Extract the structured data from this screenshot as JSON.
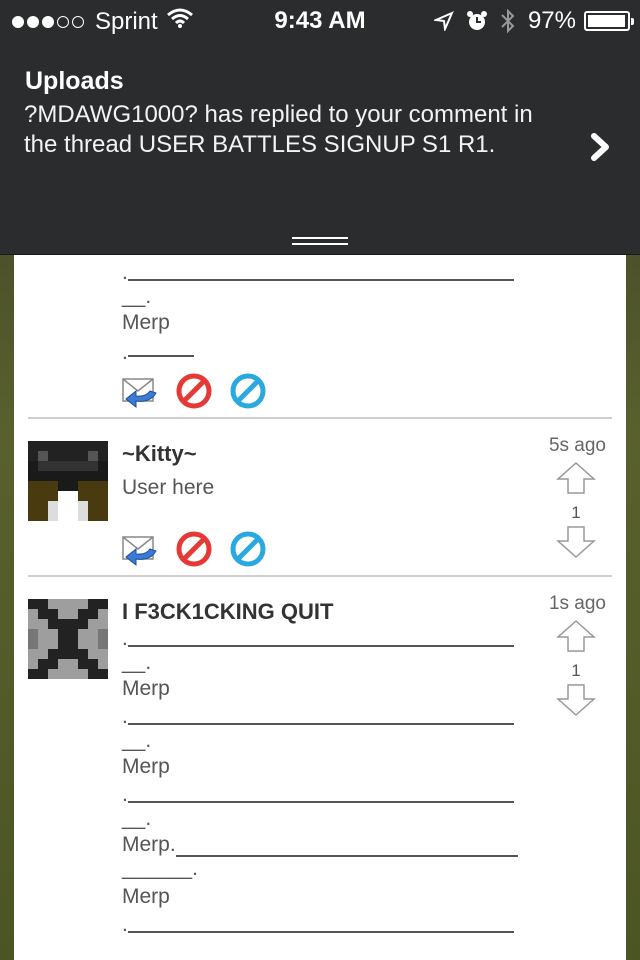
{
  "status_bar": {
    "carrier": "Sprint",
    "time": "9:43 AM",
    "battery": "97%",
    "battery_level": 0.97,
    "signal_bars_filled": 3,
    "signal_bars_total": 5
  },
  "notification": {
    "title": "Uploads",
    "line1": "?MDAWG1000? has replied to your comment in",
    "line2": "the thread USER BATTLES SIGNUP S1 R1."
  },
  "comments": [
    {
      "lines": [
        ".",
        "__.",
        "Merp",
        "."
      ],
      "actions": [
        "reply-icon",
        "block-icon",
        "flag-icon"
      ]
    },
    {
      "username": "~Kitty~",
      "body": "User here",
      "time": "5s ago",
      "votes": "1",
      "actions": [
        "reply-icon",
        "block-icon",
        "flag-icon"
      ]
    },
    {
      "username": "I F3CK1CKING QUIT",
      "time": "1s ago",
      "votes": "1",
      "lines": [
        ".",
        "__.",
        "Merp",
        ".",
        "__.",
        "Merp",
        ".",
        "__.",
        "Merp.",
        "______.",
        "Merp",
        "."
      ]
    }
  ],
  "colors": {
    "banner": "#2b2c2d",
    "reply": "#3a7bd5",
    "block": "#e53935",
    "flag": "#29a9e0"
  }
}
